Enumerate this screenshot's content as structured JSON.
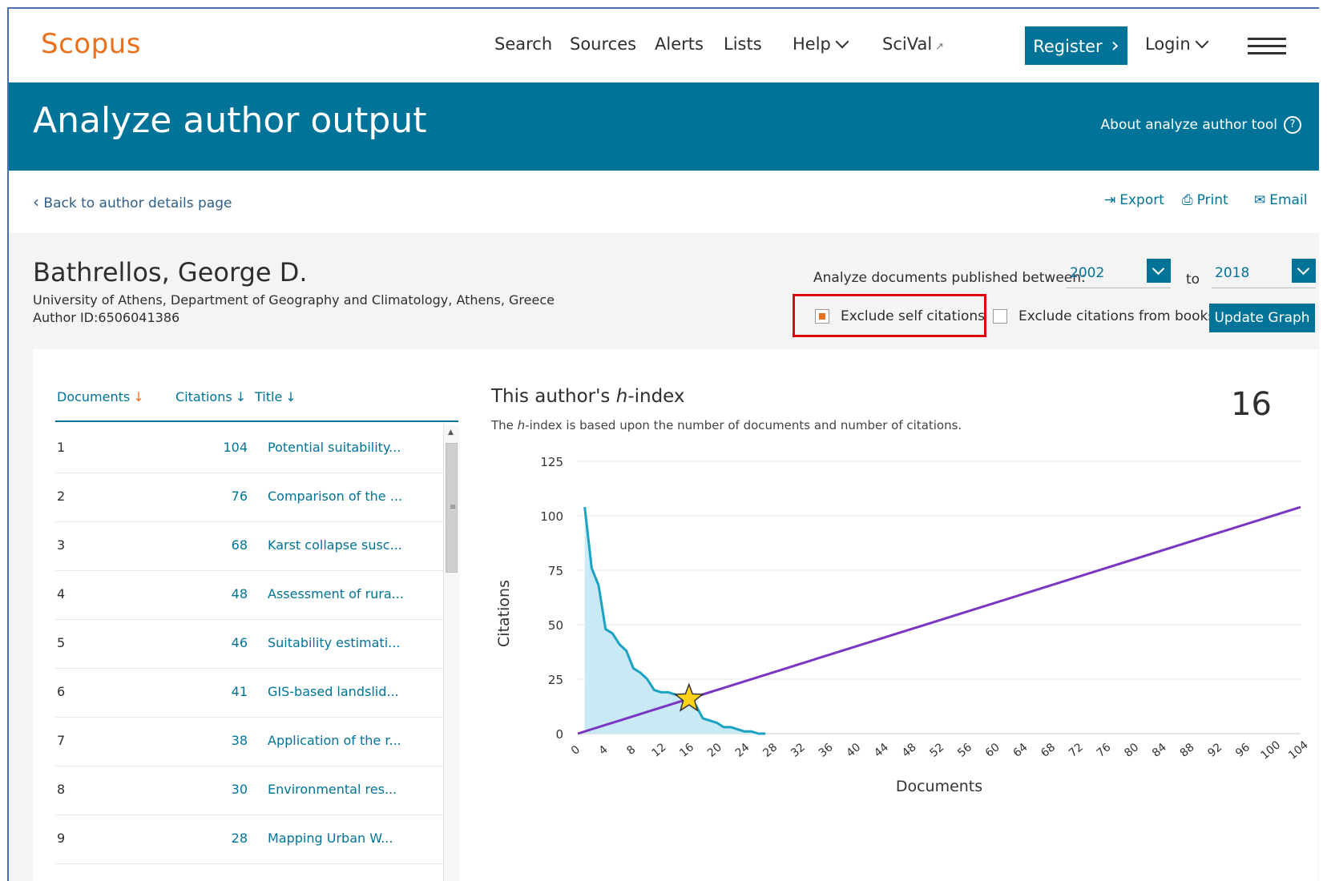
{
  "nav": {
    "logo": "Scopus",
    "items": [
      "Search",
      "Sources",
      "Alerts",
      "Lists",
      "Help",
      "SciVal"
    ],
    "sciVal_mark": "↗",
    "register": "Register",
    "register_arrow": "›",
    "login": "Login"
  },
  "banner": {
    "title": "Analyze author output",
    "about": "About analyze author tool",
    "about_icon": "?"
  },
  "actions": {
    "back": "Back to author details page",
    "back_chevron": "‹",
    "export": "Export",
    "print": "Print",
    "email": "Email"
  },
  "author": {
    "name": "Bathrellos, George D.",
    "affiliation": "University of Athens, Department of Geography and Climatology, Athens, Greece",
    "author_id": "Author ID:6506041386"
  },
  "filters": {
    "range_label": "Analyze documents published between:",
    "from_year": "2002",
    "to_label": "to",
    "to_year": "2018",
    "exclude_self": "Exclude self citations",
    "exclude_self_checked": true,
    "exclude_books": "Exclude citations from books",
    "exclude_books_checked": false,
    "update_button": "Update Graph"
  },
  "table": {
    "headers": {
      "documents": "Documents",
      "citations": "Citations",
      "title": "Title",
      "sort_arrow": "↓"
    },
    "rows": [
      {
        "idx": "1",
        "citations": "104",
        "title": "Potential suitability..."
      },
      {
        "idx": "2",
        "citations": "76",
        "title": "Comparison of the ..."
      },
      {
        "idx": "3",
        "citations": "68",
        "title": "Karst collapse susc..."
      },
      {
        "idx": "4",
        "citations": "48",
        "title": "Assessment of rura..."
      },
      {
        "idx": "5",
        "citations": "46",
        "title": "Suitability estimati..."
      },
      {
        "idx": "6",
        "citations": "41",
        "title": "GIS-based landslid..."
      },
      {
        "idx": "7",
        "citations": "38",
        "title": "Application of the r..."
      },
      {
        "idx": "8",
        "citations": "30",
        "title": "Environmental res..."
      },
      {
        "idx": "9",
        "citations": "28",
        "title": "Mapping Urban W..."
      }
    ]
  },
  "hindex": {
    "title_prefix": "This author's ",
    "title_h": "h",
    "title_suffix": "-index",
    "sub_prefix": "The ",
    "sub_h": "h",
    "sub_suffix": "-index is based upon the number of documents and number of citations.",
    "value": "16"
  },
  "chart_data": {
    "type": "area",
    "xlabel": "Documents",
    "ylabel": "Citations",
    "xlim": [
      0,
      104
    ],
    "ylim": [
      0,
      125
    ],
    "xticks": [
      0,
      4,
      8,
      12,
      16,
      20,
      24,
      28,
      32,
      36,
      40,
      44,
      48,
      52,
      56,
      60,
      64,
      68,
      72,
      76,
      80,
      84,
      88,
      92,
      96,
      100,
      104
    ],
    "yticks": [
      0,
      25,
      50,
      75,
      100,
      125
    ],
    "citation_curve": {
      "x": [
        1,
        2,
        3,
        4,
        5,
        6,
        7,
        8,
        9,
        10,
        11,
        12,
        13,
        14,
        15,
        16,
        17,
        18,
        19,
        20,
        21,
        22,
        23,
        24,
        25,
        26,
        27
      ],
      "y": [
        104,
        76,
        68,
        48,
        46,
        41,
        38,
        30,
        28,
        25,
        20,
        19,
        19,
        18,
        17,
        16,
        13,
        7,
        6,
        5,
        3,
        3,
        2,
        1,
        1,
        0,
        0
      ]
    },
    "diagonal": {
      "x": [
        0,
        104
      ],
      "y": [
        0,
        104
      ]
    },
    "h_index_point": {
      "x": 16,
      "y": 16
    },
    "grid": true,
    "colors": {
      "area": "#c9e9f4",
      "curve": "#1aa2c2",
      "diagonal": "#7a35c2",
      "star": "#ffd21a",
      "grid": "#e3e3e3"
    }
  }
}
